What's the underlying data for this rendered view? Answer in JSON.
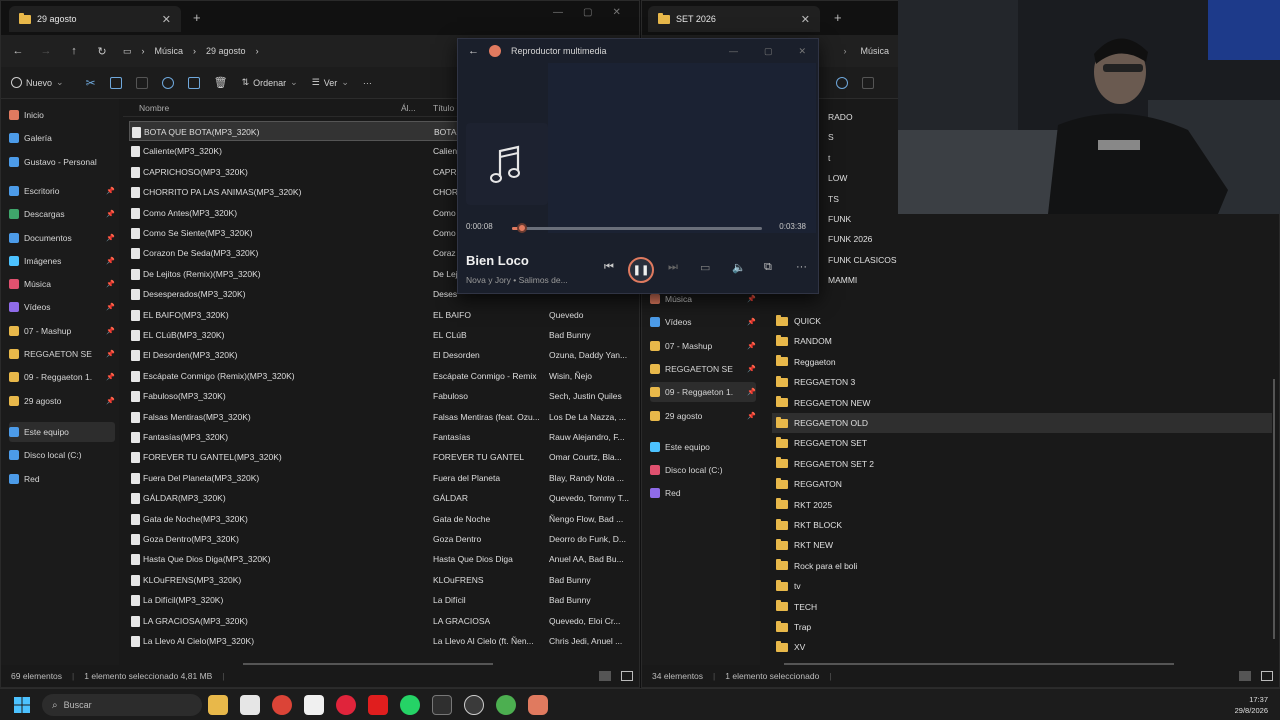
{
  "left_window": {
    "tab_title": "29 agosto",
    "breadcrumb": [
      "Música",
      "29 agosto"
    ],
    "toolbar": {
      "new": "Nuevo",
      "sort": "Ordenar",
      "view": "Ver"
    },
    "nav_items": [
      {
        "label": "Inicio",
        "pinned": false
      },
      {
        "label": "Galería",
        "pinned": false
      },
      {
        "label": "Gustavo - Personal",
        "pinned": false
      },
      {
        "label": "Escritorio",
        "pinned": true
      },
      {
        "label": "Descargas",
        "pinned": true
      },
      {
        "label": "Documentos",
        "pinned": true
      },
      {
        "label": "Imágenes",
        "pinned": true
      },
      {
        "label": "Música",
        "pinned": true
      },
      {
        "label": "Vídeos",
        "pinned": true
      },
      {
        "label": "07 - Mashup",
        "pinned": true
      },
      {
        "label": "REGGAETON SE",
        "pinned": true
      },
      {
        "label": "09 - Reggaeton 1.",
        "pinned": true
      },
      {
        "label": "29 agosto",
        "pinned": true
      },
      {
        "label": "Este equipo",
        "pinned": false
      },
      {
        "label": "Disco local (C:)",
        "pinned": false
      },
      {
        "label": "Red",
        "pinned": false
      }
    ],
    "columns": {
      "name": "Nombre",
      "album": "Ál...",
      "title": "Título"
    },
    "files": [
      {
        "name": "BOTA QUE BOTA(MP3_320K)",
        "title": "BOTA",
        "artist": ""
      },
      {
        "name": "Caliente(MP3_320K)",
        "title": "Calien",
        "artist": ""
      },
      {
        "name": "CAPRICHOSO(MP3_320K)",
        "title": "CAPRI",
        "artist": ""
      },
      {
        "name": "CHORRITO PA LAS ANIMAS(MP3_320K)",
        "title": "CHOR",
        "artist": ""
      },
      {
        "name": "Como Antes(MP3_320K)",
        "title": "Como",
        "artist": ""
      },
      {
        "name": "Como Se Siente(MP3_320K)",
        "title": "Como",
        "artist": ""
      },
      {
        "name": "Corazon De Seda(MP3_320K)",
        "title": "Coraz",
        "artist": ""
      },
      {
        "name": "De Lejitos (Remix)(MP3_320K)",
        "title": "De Lej",
        "artist": ""
      },
      {
        "name": "Desesperados(MP3_320K)",
        "title": "Deses",
        "artist": ""
      },
      {
        "name": "EL BAIFO(MP3_320K)",
        "title": "EL BAIFO",
        "artist": "Quevedo"
      },
      {
        "name": "EL CLúB(MP3_320K)",
        "title": "EL CLúB",
        "artist": "Bad Bunny"
      },
      {
        "name": "El Desorden(MP3_320K)",
        "title": "El Desorden",
        "artist": "Ozuna, Daddy Yan..."
      },
      {
        "name": "Escápate Conmigo (Remix)(MP3_320K)",
        "title": "Escápate Conmigo - Remix",
        "artist": "Wisin, Ñejo"
      },
      {
        "name": "Fabuloso(MP3_320K)",
        "title": "Fabuloso",
        "artist": "Sech, Justin Quiles"
      },
      {
        "name": "Falsas Mentiras(MP3_320K)",
        "title": "Falsas Mentiras (feat. Ozu...",
        "artist": "Los De La Nazza, ..."
      },
      {
        "name": "Fantasías(MP3_320K)",
        "title": "Fantasías",
        "artist": "Rauw Alejandro, F..."
      },
      {
        "name": "FOREVER TU GANTEL(MP3_320K)",
        "title": "FOREVER TU GANTEL",
        "artist": "Omar Courtz, Bla..."
      },
      {
        "name": "Fuera Del Planeta(MP3_320K)",
        "title": "Fuera del Planeta",
        "artist": "Blay, Randy Nota ..."
      },
      {
        "name": "GÁLDAR(MP3_320K)",
        "title": "GÁLDAR",
        "artist": "Quevedo, Tommy T..."
      },
      {
        "name": "Gata de Noche(MP3_320K)",
        "title": "Gata de Noche",
        "artist": "Ñengo Flow, Bad ..."
      },
      {
        "name": "Goza Dentro(MP3_320K)",
        "title": "Goza Dentro",
        "artist": "Deorro do Funk, D..."
      },
      {
        "name": "Hasta Que Dios Diga(MP3_320K)",
        "title": "Hasta Que Dios Diga",
        "artist": "Anuel AA, Bad Bu..."
      },
      {
        "name": "KLOuFRENS(MP3_320K)",
        "title": "KLOuFRENS",
        "artist": "Bad Bunny"
      },
      {
        "name": "La Difícil(MP3_320K)",
        "title": "La Difícil",
        "artist": "Bad Bunny"
      },
      {
        "name": "LA GRACIOSA(MP3_320K)",
        "title": "LA GRACIOSA",
        "artist": "Quevedo, Eloi Cr..."
      },
      {
        "name": "La Llevo Al Cielo(MP3_320K)",
        "title": "La Llevo Al Cielo (ft. Ñen...",
        "artist": "Chris Jedi, Anuel ..."
      }
    ],
    "status": {
      "count": "69 elementos",
      "selected": "1 elemento seleccionado  4,81 MB"
    }
  },
  "right_window": {
    "tab_title": "SET 2026",
    "breadcrumb": [
      "Música"
    ],
    "nav_items": [
      {
        "label": "Música",
        "pinned": true
      },
      {
        "label": "Vídeos",
        "pinned": true
      },
      {
        "label": "07 - Mashup",
        "pinned": true
      },
      {
        "label": "REGGAETON SE",
        "pinned": true
      },
      {
        "label": "09 - Reggaeton 1.",
        "pinned": true
      },
      {
        "label": "29 agosto",
        "pinned": true
      },
      {
        "label": "Este equipo",
        "pinned": false
      },
      {
        "label": "Disco local (C:)",
        "pinned": false
      },
      {
        "label": "Red",
        "pinned": false
      }
    ],
    "folders_partial": [
      "RADO",
      "S",
      "t",
      "LOW",
      "TS",
      "FUNK",
      "FUNK 2026",
      "FUNK CLASICOS",
      "MAMMI"
    ],
    "folders": [
      "QUICK",
      "RANDOM",
      "Reggaeton",
      "REGGAETON 3",
      "REGGAETON NEW",
      "REGGAETON OLD",
      "REGGAETON SET",
      "REGGAETON SET 2",
      "REGGATON",
      "RKT 2025",
      "RKT BLOCK",
      "RKT NEW",
      "Rock para el boli",
      "tv",
      "TECH",
      "Trap",
      "XV"
    ],
    "status": {
      "count": "34 elementos",
      "selected": "1 elemento seleccionado"
    }
  },
  "player": {
    "app_title": "Reproductor multimedia",
    "elapsed": "0:00:08",
    "duration": "0:03:38",
    "progress": 0.04,
    "track_title": "Bien Loco",
    "track_sub": "Nova y Jory • Salimos de..."
  },
  "taskbar": {
    "search_placeholder": "Buscar",
    "time": "17:37",
    "date": "29/8/2026"
  }
}
